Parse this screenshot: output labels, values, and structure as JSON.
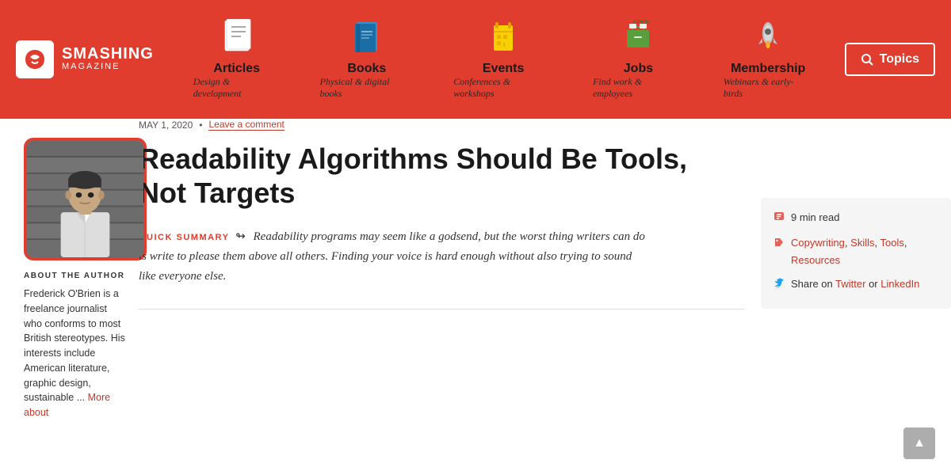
{
  "site": {
    "name_bold": "SMASHING",
    "name_thin": "MAGAZINE"
  },
  "nav": {
    "items": [
      {
        "id": "articles",
        "label": "Articles",
        "sub": "Design & development",
        "icon": "📄"
      },
      {
        "id": "books",
        "label": "Books",
        "sub": "Physical & digital books",
        "icon": "📘"
      },
      {
        "id": "events",
        "label": "Events",
        "sub": "Conferences & workshops",
        "icon": "🎫"
      },
      {
        "id": "jobs",
        "label": "Jobs",
        "sub": "Find work & employees",
        "icon": "💼"
      },
      {
        "id": "membership",
        "label": "Membership",
        "sub": "Webinars & early-birds",
        "icon": "🚀"
      }
    ],
    "topics_label": "Topics"
  },
  "article": {
    "date": "MAY 1, 2020",
    "separator": "•",
    "comment_link": "Leave a comment",
    "title": "Readability Algorithms Should Be Tools, Not Targets",
    "qs_label": "QUICK SUMMARY",
    "qs_arrow": "↬",
    "qs_body": "Readability programs may seem like a godsend, but the worst thing writers can do is write to please them above all others. Finding your voice is hard enough without also trying to sound like everyone else.",
    "read_time": "9 min read",
    "tags": [
      "Copywriting",
      "Skills",
      "Tools",
      "Resources"
    ],
    "share_prefix": "Share on",
    "share_twitter": "Twitter",
    "share_or": "or",
    "share_linkedin": "LinkedIn"
  },
  "author": {
    "about_label": "ABOUT THE AUTHOR",
    "bio": "Frederick O'Brien is a freelance journalist who conforms to most British stereotypes. His interests include American literature, graphic design, sustainable ...",
    "more_label": "More about"
  }
}
